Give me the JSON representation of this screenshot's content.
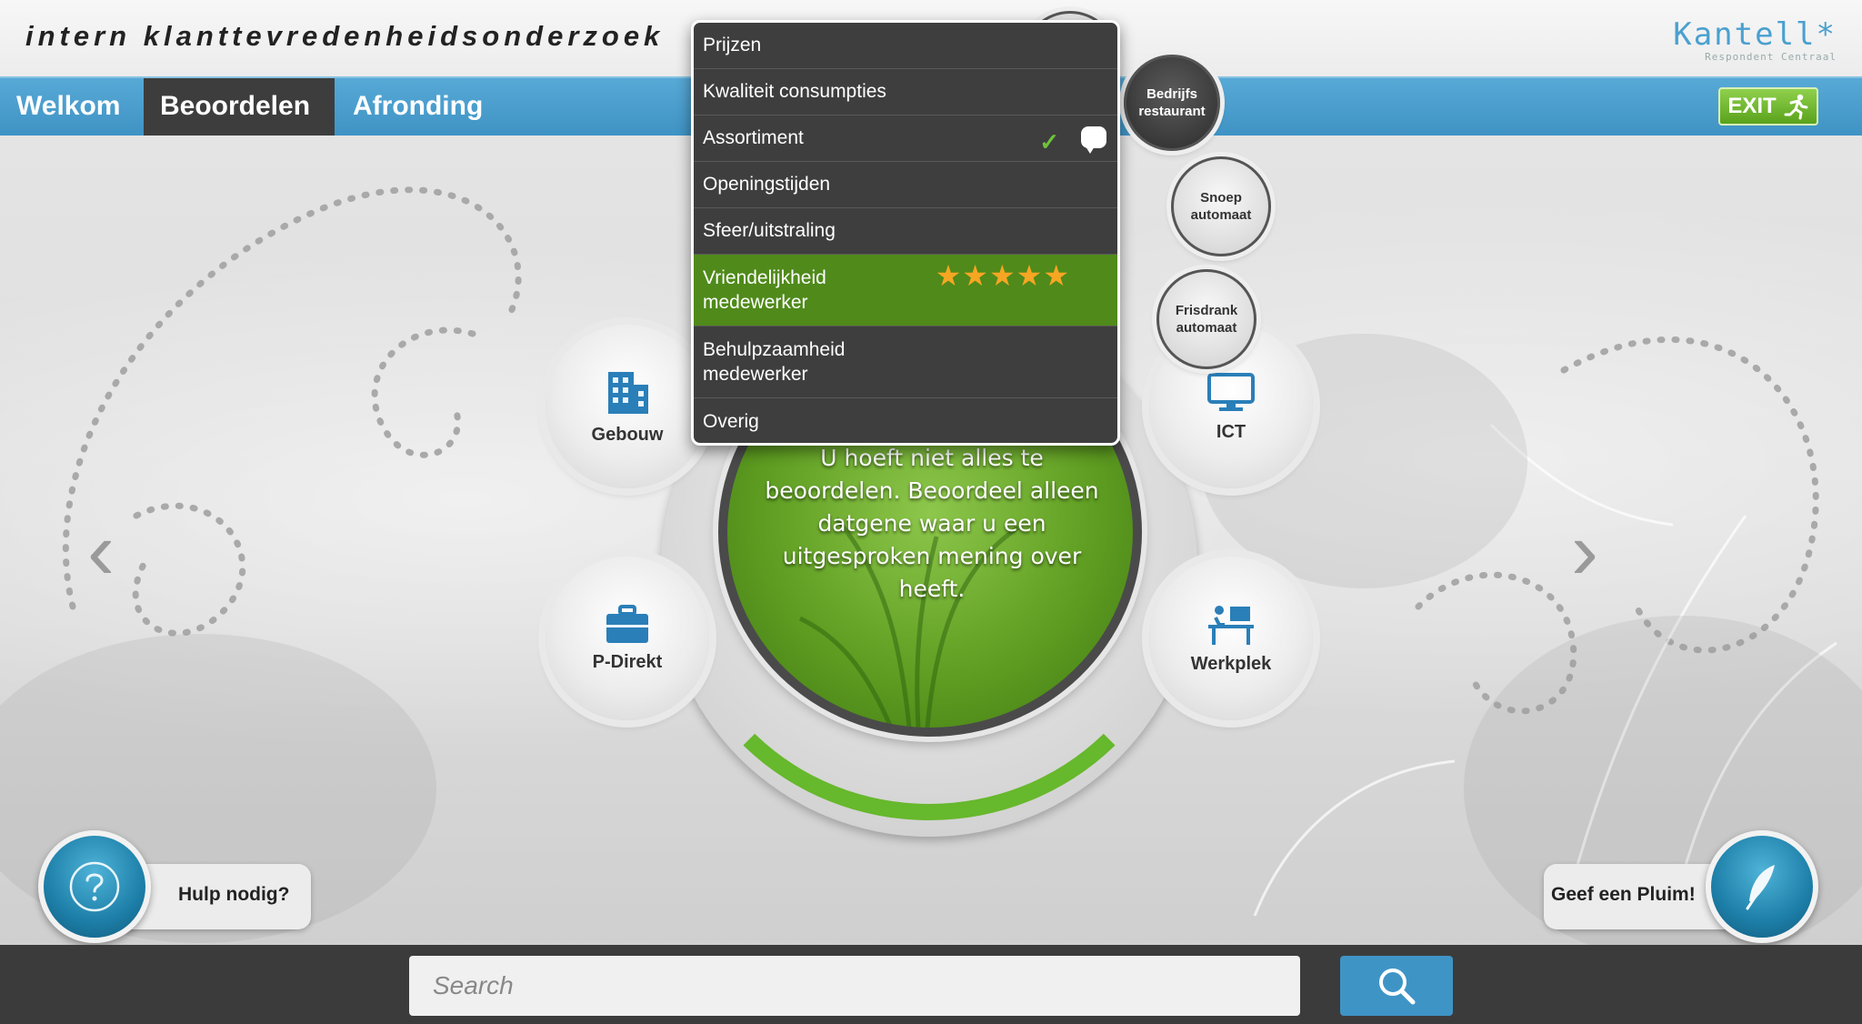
{
  "header": {
    "title": "intern klanttevredenheidsonderzoek",
    "logo": "Kantell*",
    "logo_sub": "Respondent Centraal"
  },
  "nav": {
    "tabs": [
      {
        "label": "Welkom"
      },
      {
        "label": "Beoordelen"
      },
      {
        "label": "Afronding"
      }
    ],
    "active_tab": "Beoordelen",
    "exit_label": "EXIT"
  },
  "menu": {
    "items": [
      {
        "label": "Prijzen"
      },
      {
        "label": "Kwaliteit consumpties"
      },
      {
        "label": "Assortiment"
      },
      {
        "label": "Openingstijden"
      },
      {
        "label": "Sfeer/uitstraling"
      },
      {
        "label": "Vriendelijkheid medewerker"
      },
      {
        "label": "Behulpzaamheid medewerker"
      },
      {
        "label": "Overig"
      }
    ],
    "selected": "Vriendelijkheid medewerker",
    "rating_stars": 5,
    "rating_text": "★★★★★"
  },
  "subcategories": {
    "restaurant": "Bedrijfs restaurant",
    "snoep": "Snoep automaat",
    "frisdrank": "Frisdrank automaat"
  },
  "categories": {
    "gebouw": "Gebouw",
    "ict": "ICT",
    "pdirekt": "P-Direkt",
    "werkplek": "Werkplek"
  },
  "center": {
    "message": "U hoeft niet alles te beoordelen. Beoordeel alleen datgene waar u een uitgesproken mening over heeft."
  },
  "help": {
    "label": "Hulp nodig?"
  },
  "plume": {
    "label": "Geef een Pluim!"
  },
  "search": {
    "placeholder": "Search",
    "value": ""
  },
  "colors": {
    "accent_blue": "#4a9fd0",
    "selected_green": "#4f8a1a",
    "star_orange": "#f5a623",
    "check_green": "#6ec33a"
  }
}
